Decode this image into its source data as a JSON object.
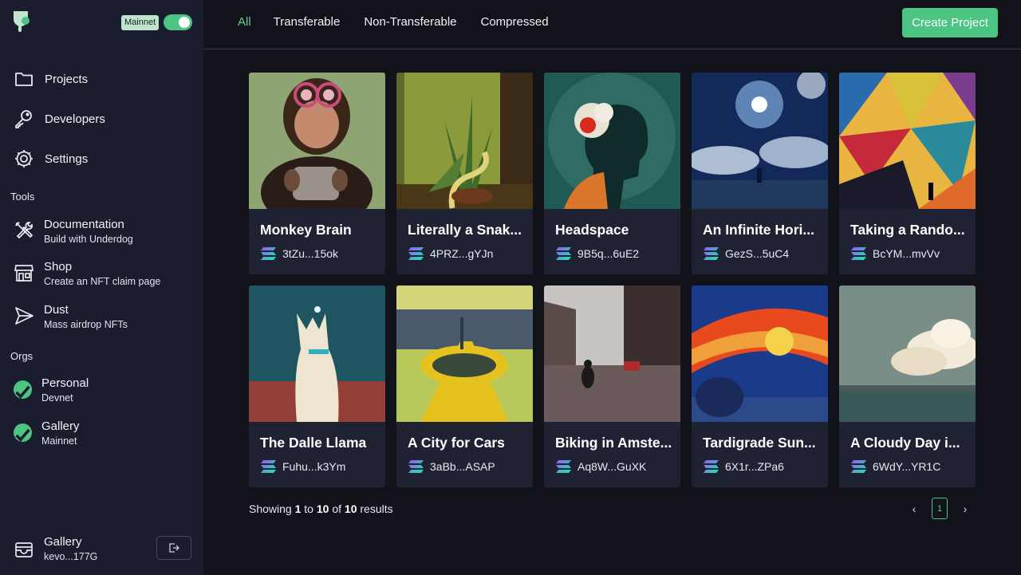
{
  "sidebar": {
    "network_badge": "Mainnet",
    "network_toggle_on": true,
    "nav": [
      {
        "label": "Projects",
        "icon": "folder-icon"
      },
      {
        "label": "Developers",
        "icon": "key-icon"
      },
      {
        "label": "Settings",
        "icon": "gear-icon"
      }
    ],
    "tools_label": "Tools",
    "tools": [
      {
        "title": "Documentation",
        "subtitle": "Build with Underdog",
        "icon": "tools-icon"
      },
      {
        "title": "Shop",
        "subtitle": "Create an NFT claim page",
        "icon": "store-icon"
      },
      {
        "title": "Dust",
        "subtitle": "Mass airdrop NFTs",
        "icon": "send-icon"
      }
    ],
    "orgs_label": "Orgs",
    "orgs": [
      {
        "title": "Personal",
        "subtitle": "Devnet"
      },
      {
        "title": "Gallery",
        "subtitle": "Mainnet"
      }
    ],
    "wallet": {
      "title": "Gallery",
      "subtitle": "kevo...177G"
    }
  },
  "topbar": {
    "tabs": [
      "All",
      "Transferable",
      "Non-Transferable",
      "Compressed"
    ],
    "active_tab": "All",
    "create_button": "Create Project"
  },
  "projects": [
    {
      "title": "Monkey Brain",
      "address": "3tZu...15ok"
    },
    {
      "title": "Literally a Snak...",
      "address": "4PRZ...gYJn"
    },
    {
      "title": "Headspace",
      "address": "9B5q...6uE2"
    },
    {
      "title": "An Infinite Hori...",
      "address": "GezS...5uC4"
    },
    {
      "title": "Taking a Rando...",
      "address": "BcYM...mvVv"
    },
    {
      "title": "The Dalle Llama",
      "address": "Fuhu...k3Ym"
    },
    {
      "title": "A City for Cars",
      "address": "3aBb...ASAP"
    },
    {
      "title": "Biking in Amste...",
      "address": "Aq8W...GuXK"
    },
    {
      "title": "Tardigrade Sun...",
      "address": "6X1r...ZPa6"
    },
    {
      "title": "A Cloudy Day i...",
      "address": "6WdY...YR1C"
    }
  ],
  "pagination": {
    "showing": "Showing",
    "from": "1",
    "to_word": "to",
    "to": "10",
    "of_word": "of",
    "total": "10",
    "results_word": "results",
    "current_page": "1",
    "prev": "‹",
    "next": "›"
  },
  "colors": {
    "accent": "#4cc482",
    "sidebar": "#1a1d2e",
    "background": "#12121a",
    "card": "#1f2233"
  }
}
